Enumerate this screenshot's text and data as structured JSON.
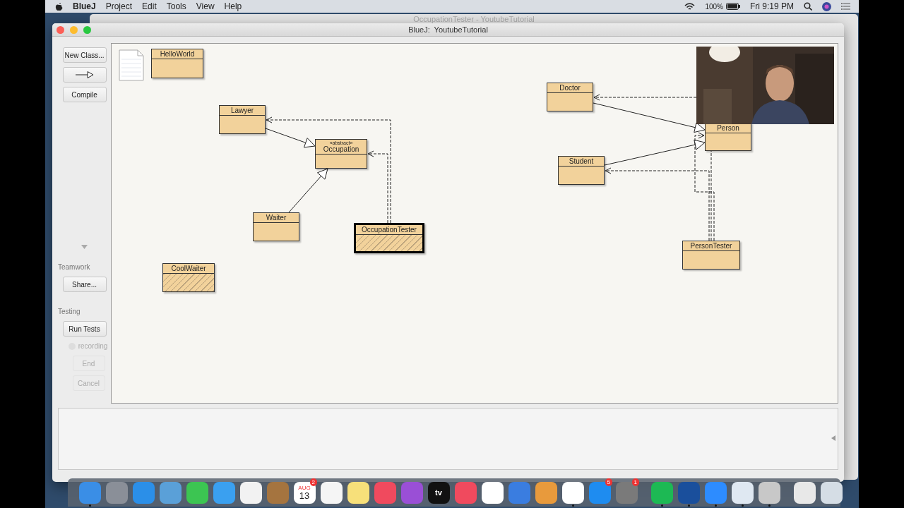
{
  "menu_bar": {
    "app": "BlueJ",
    "items": [
      "Project",
      "Edit",
      "Tools",
      "View",
      "Help"
    ],
    "battery": "100%",
    "clock": "Fri 9:19 PM"
  },
  "background_window": {
    "title": "OccupationTester - YoutubeTutorial"
  },
  "window": {
    "title": "BlueJ:  YoutubeTutorial"
  },
  "toolbar": {
    "buttons": [
      {
        "kind": "text",
        "label": "New Class..."
      },
      {
        "kind": "arrow"
      },
      {
        "kind": "text",
        "label": "Compile"
      }
    ],
    "teamwork": {
      "label": "Teamwork",
      "button": "Share..."
    },
    "testing": {
      "label": "Testing",
      "run": "Run Tests",
      "recording": {
        "label": "recording",
        "on": false
      },
      "end": {
        "label": "End",
        "disabled": true
      },
      "cancel": {
        "label": "Cancel",
        "disabled": true
      }
    }
  },
  "classes": [
    {
      "name": "HelloWorld",
      "compiled": true,
      "selected": false
    },
    {
      "name": "Lawyer",
      "compiled": true,
      "selected": false
    },
    {
      "name": "Occupation",
      "stereotype": "«abstract»",
      "compiled": true,
      "selected": false
    },
    {
      "name": "Waiter",
      "compiled": true,
      "selected": false
    },
    {
      "name": "OccupationTester",
      "compiled": false,
      "selected": true
    },
    {
      "name": "CoolWaiter",
      "compiled": false,
      "selected": false
    },
    {
      "name": "Doctor",
      "compiled": true,
      "selected": false
    },
    {
      "name": "Person",
      "compiled": true,
      "selected": false
    },
    {
      "name": "Student",
      "compiled": true,
      "selected": false
    },
    {
      "name": "PersonTester",
      "compiled": true,
      "selected": false
    }
  ],
  "dock": [
    {
      "color": "#3a8ee6",
      "running": true
    },
    {
      "color": "#8a8f98",
      "running": false
    },
    {
      "color": "#2b8fe8",
      "running": false
    },
    {
      "color": "#5aa0d8",
      "running": false
    },
    {
      "color": "#3cc552",
      "running": false
    },
    {
      "color": "#3aa0f0",
      "running": false
    },
    {
      "color": "#f2f2f2",
      "running": false
    },
    {
      "color": "#a5743f",
      "running": false
    },
    {
      "color": "#ffffff",
      "running": false,
      "month": "AUG",
      "day": "13",
      "badge": "2"
    },
    {
      "color": "#f5f5f5",
      "running": false
    },
    {
      "color": "#f7e07a",
      "running": false
    },
    {
      "color": "#f04a5e",
      "running": false
    },
    {
      "color": "#9a4fd6",
      "running": false
    },
    {
      "color": "#111111",
      "running": false,
      "text": "tv"
    },
    {
      "color": "#f04a5e",
      "running": false
    },
    {
      "color": "#ffffff",
      "running": false
    },
    {
      "color": "#3a7de0",
      "running": false
    },
    {
      "color": "#e89a3c",
      "running": false
    },
    {
      "color": "#ffffff",
      "running": true
    },
    {
      "color": "#1e8cf0",
      "running": false,
      "badge": "5"
    },
    {
      "color": "#7a7a7a",
      "running": false,
      "badge": "1"
    },
    {
      "color": "#1db954",
      "running": true
    },
    {
      "color": "#1a4f9c",
      "running": true
    },
    {
      "color": "#2d8cff",
      "running": true
    },
    {
      "color": "#dfe8f2",
      "running": true
    },
    {
      "color": "#c8c8c8",
      "running": true
    },
    {
      "color": "#e8e8e8",
      "running": false
    },
    {
      "color": "#d5dde5",
      "running": false
    }
  ]
}
